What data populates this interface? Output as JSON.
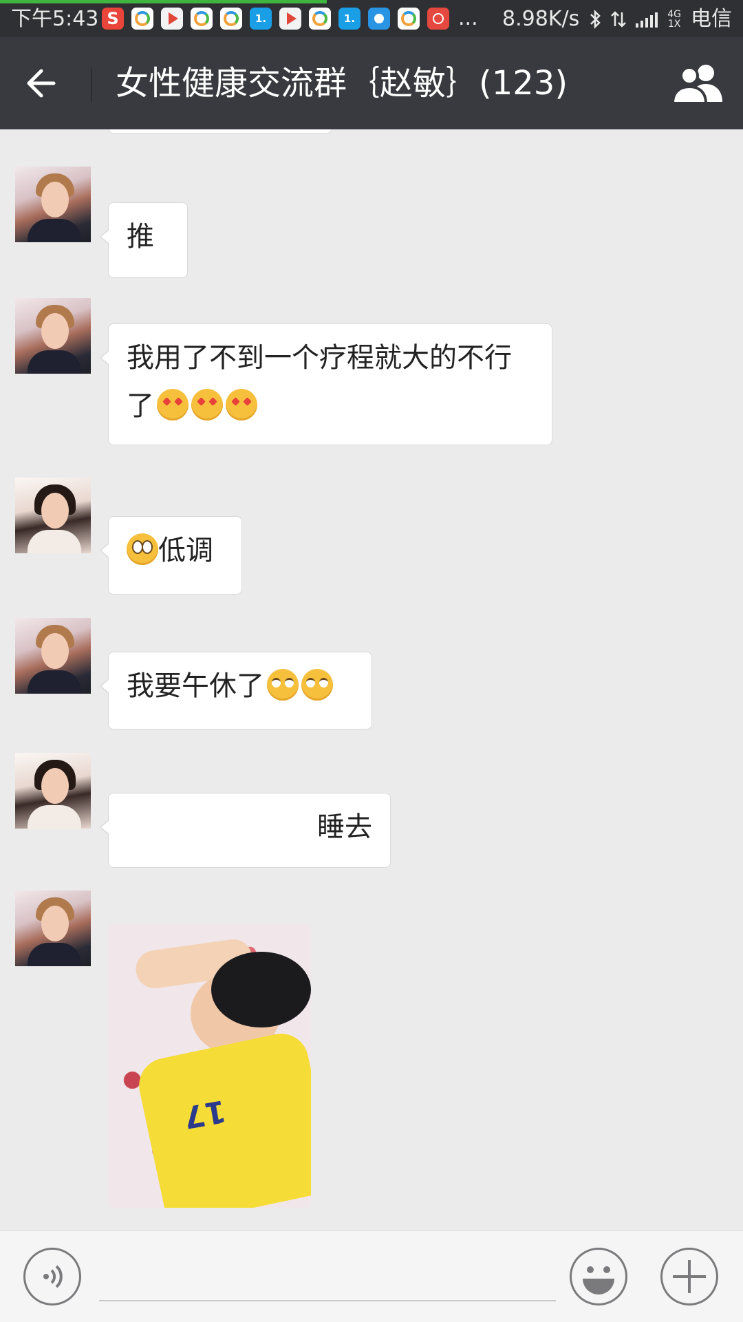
{
  "status_bar": {
    "time": "下午5:43",
    "net_speed": "8.98K/s",
    "network_type_top": "4G",
    "network_type_bottom": "1X",
    "carrier": "电信",
    "more": "...",
    "progress_fraction": 0.44,
    "app_icons": [
      "sogou-icon",
      "browser-icon",
      "play-icon",
      "browser-icon",
      "browser-icon",
      "news-icon",
      "play-icon",
      "browser-icon",
      "news-icon",
      "note-icon",
      "browser-icon",
      "chart-icon"
    ],
    "sogou_letter": "S",
    "news_letter": "1."
  },
  "nav": {
    "title": "女性健康交流群｛赵敏｝(123)"
  },
  "messages": [
    {
      "sender_avatar": "avatar-1",
      "type": "text",
      "text": "推"
    },
    {
      "sender_avatar": "avatar-1",
      "type": "text",
      "text": "我用了不到一个疗程就大的不行了",
      "emoji": [
        "love-eyes",
        "love-eyes",
        "love-eyes"
      ]
    },
    {
      "sender_avatar": "avatar-2",
      "type": "text",
      "text": "低调",
      "emoji_before": [
        "flushed"
      ]
    },
    {
      "sender_avatar": "avatar-1",
      "type": "text",
      "text": "我要午休了",
      "emoji": [
        "eye-roll",
        "eye-roll"
      ]
    },
    {
      "sender_avatar": "avatar-2",
      "type": "text",
      "text": "睡去"
    },
    {
      "sender_avatar": "avatar-1",
      "type": "image",
      "image_text": "17"
    }
  ],
  "input": {
    "value": "",
    "placeholder": ""
  },
  "colors": {
    "status_bar": "#2f3033",
    "nav_bar": "#393a3f",
    "chat_background": "#ebebeb",
    "bubble": "#ffffff",
    "progress": "#3fb53f"
  }
}
